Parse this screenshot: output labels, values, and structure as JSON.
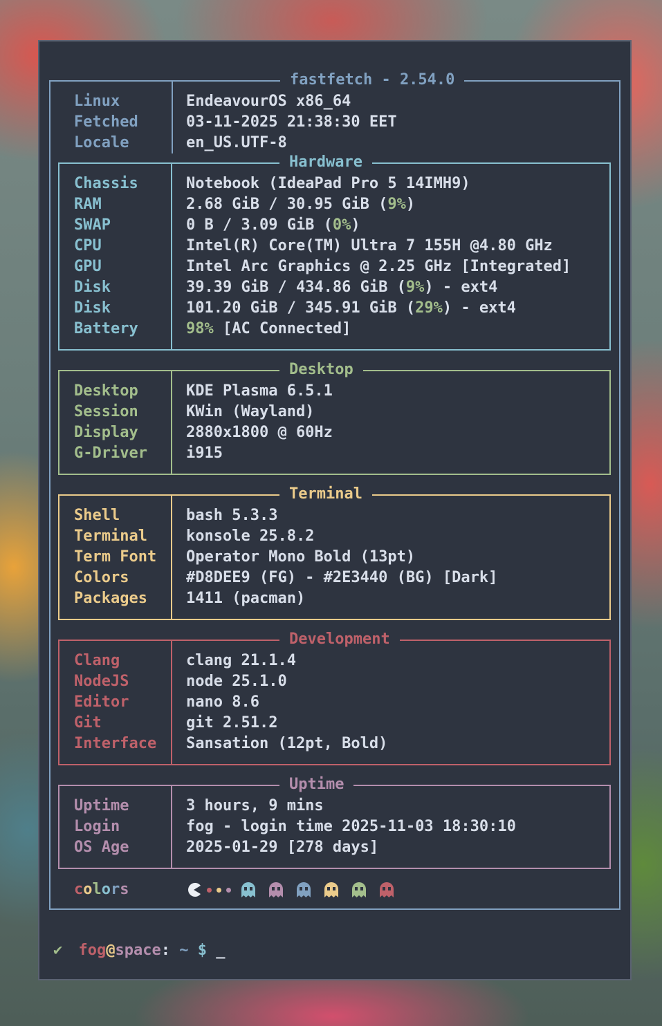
{
  "header": {
    "title": "fastfetch - 2.54.0"
  },
  "top": [
    {
      "key": "Linux",
      "value": "EndeavourOS x86_64"
    },
    {
      "key": "Fetched",
      "value": "03-11-2025 21:38:30 EET"
    },
    {
      "key": "Locale",
      "value": "en_US.UTF-8"
    }
  ],
  "hardware": {
    "title": "Hardware",
    "chassis": {
      "key": "Chassis",
      "value": "Notebook (IdeaPad Pro 5 14IMH9)"
    },
    "ram": {
      "key": "RAM",
      "pre": "2.68 GiB / 30.95 GiB (",
      "pct": "9%",
      "post": ")"
    },
    "swap": {
      "key": "SWAP",
      "pre": "0 B / 3.09 GiB (",
      "pct": "0%",
      "post": ")"
    },
    "cpu": {
      "key": "CPU",
      "value": "Intel(R) Core(TM) Ultra 7 155H @4.80 GHz"
    },
    "gpu": {
      "key": "GPU",
      "value": "Intel Arc Graphics @ 2.25 GHz [Integrated]"
    },
    "disk1": {
      "key": "Disk",
      "pre": "39.39 GiB / 434.86 GiB (",
      "pct": "9%",
      "post": ") - ext4"
    },
    "disk2": {
      "key": "Disk",
      "pre": "101.20 GiB / 345.91 GiB (",
      "pct": "29%",
      "post": ") - ext4"
    },
    "battery": {
      "key": "Battery",
      "pct": "98%",
      "post": " [AC Connected]"
    }
  },
  "desktop": {
    "title": "Desktop",
    "rows": [
      {
        "key": "Desktop",
        "value": "KDE Plasma 6.5.1"
      },
      {
        "key": "Session",
        "value": "KWin (Wayland)"
      },
      {
        "key": "Display",
        "value": "2880x1800 @ 60Hz"
      },
      {
        "key": "G-Driver",
        "value": "i915"
      }
    ]
  },
  "terminal": {
    "title": "Terminal",
    "rows": [
      {
        "key": "Shell",
        "value": "bash 5.3.3"
      },
      {
        "key": "Terminal",
        "value": "konsole 25.8.2"
      },
      {
        "key": "Term Font",
        "value": "Operator Mono Bold (13pt)"
      },
      {
        "key": "Colors",
        "value": "#D8DEE9 (FG) - #2E3440 (BG) [Dark]"
      },
      {
        "key": "Packages",
        "value": "1411 (pacman)"
      }
    ]
  },
  "development": {
    "title": "Development",
    "rows": [
      {
        "key": "Clang",
        "value": "clang 21.1.4"
      },
      {
        "key": "NodeJS",
        "value": "node 25.1.0"
      },
      {
        "key": "Editor",
        "value": "nano 8.6"
      },
      {
        "key": "Git",
        "value": "git 2.51.2"
      },
      {
        "key": "Interface",
        "value": "Sansation (12pt, Bold)"
      }
    ]
  },
  "uptime": {
    "title": "Uptime",
    "rows": [
      {
        "key": "Uptime",
        "value": "3 hours, 9 mins"
      },
      {
        "key": "Login",
        "value": "fog - login time 2025-11-03 18:30:10"
      },
      {
        "key": "OS Age",
        "value": "2025-01-29 [278 days]"
      }
    ]
  },
  "colors": {
    "key_parts": [
      "c",
      "o",
      "l",
      "o",
      "r",
      "s"
    ],
    "key_colors": [
      "#bf616a",
      "#ebcb8b",
      "#a3be8c",
      "#88c0d0",
      "#81a1c1",
      "#b48ead"
    ],
    "pacman_color": "#eceff4",
    "dot_colors": [
      "#bf616a",
      "#ebcb8b",
      "#b48ead"
    ],
    "ghost_colors": [
      "#88c0d0",
      "#b48ead",
      "#81a1c1",
      "#ebcb8b",
      "#a3be8c",
      "#bf616a"
    ]
  },
  "prompt": {
    "check": "✔",
    "user": "fog",
    "at": "@",
    "host": "space",
    "colon": ":",
    "path": "~",
    "symbol": "$",
    "cursor": "_"
  },
  "palette": {
    "bg": "#2e3440",
    "fg": "#d8dee9",
    "blue": "#81a1c1",
    "cyan": "#88c0d0",
    "green": "#a3be8c",
    "yellow": "#ebcb8b",
    "red": "#bf616a",
    "purple": "#b48ead"
  }
}
